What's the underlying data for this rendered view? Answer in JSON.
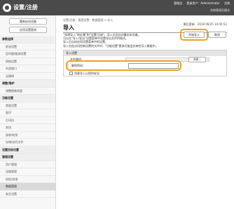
{
  "header": {
    "title": "设置/注册",
    "user_items": [
      "管理员",
      "登录用户：Administrator",
      "注销"
    ],
    "status": "系统管理员模式"
  },
  "sidebar": {
    "buttons": [
      "重新启动设备",
      "应用设置更改"
    ],
    "items": [
      {
        "label": "参数选择",
        "type": "head"
      },
      {
        "label": "纸张设置",
        "type": "sub"
      },
      {
        "label": "定时器/能源设置",
        "type": "sub"
      },
      {
        "label": "网络设置",
        "type": "sub"
      },
      {
        "label": "外部接口",
        "type": "sub"
      },
      {
        "label": "无障碍",
        "type": "sub"
      },
      {
        "label": "调整/维护",
        "type": "head"
      },
      {
        "label": "调整图像质量",
        "type": "sub"
      },
      {
        "label": "功能设置",
        "type": "head"
      },
      {
        "label": "常规设置",
        "type": "sub"
      },
      {
        "label": "复印",
        "type": "sub"
      },
      {
        "label": "打印机",
        "type": "sub"
      },
      {
        "label": "发送",
        "type": "sub"
      },
      {
        "label": "接收/转发",
        "type": "sub"
      },
      {
        "label": "存储/访问文件",
        "type": "sub"
      },
      {
        "label": "设置目标位置",
        "type": "head"
      },
      {
        "label": "管理设置",
        "type": "head"
      },
      {
        "label": "用户管理",
        "type": "sub"
      },
      {
        "label": "设备管理",
        "type": "sub"
      },
      {
        "label": "授权/其他",
        "type": "sub"
      },
      {
        "label": "数据管理",
        "type": "sub",
        "active": true
      },
      {
        "label": "安全设置",
        "type": "sub"
      }
    ]
  },
  "main": {
    "breadcrumb": "设置/注册：管理设置：数据管理 > 导入",
    "title": "导入",
    "updated": "最后更新：2019 06/25 10:45:52",
    "start_button": "开始导入",
    "cancel_button": "取消",
    "description": [
      "“如果导入\"地址簿\"和\"设置/注册\"，导入后会自动重启本设备。",
      "可以在\"导入/导出\"设置菜单中设置导出文件的格式。",
      "导入后自动应用设置菜单中的设置。",
      "导入包含访问控制设置的文件时，\"功能设置\"更改可能会反映在导入数据中。"
    ],
    "section": {
      "title": "导入设置",
      "file_label": "文件路径：",
      "browse_button": "浏览...",
      "password_label": "解密密码：",
      "password_value": "",
      "checkbox_label": "同意导入以保持安全",
      "checkbox_checked": false
    }
  },
  "colors": {
    "topbar": "#4a4a4a",
    "highlight": "#f0a020"
  }
}
